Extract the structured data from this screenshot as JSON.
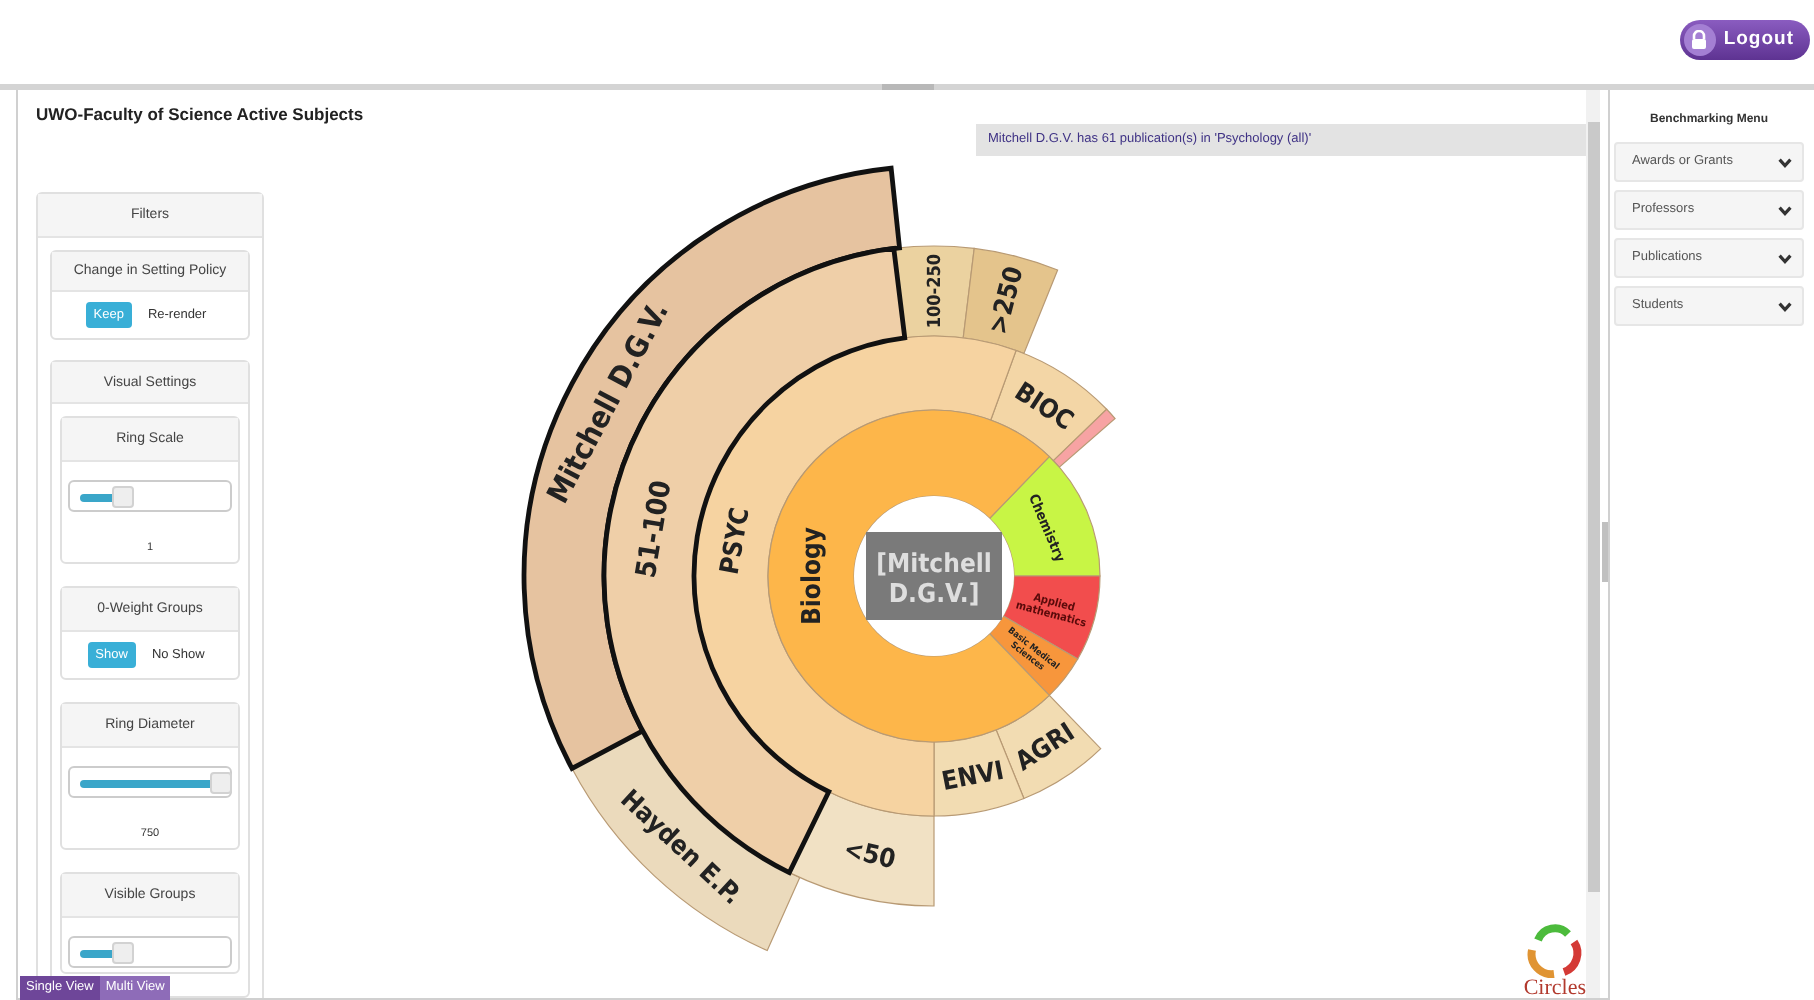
{
  "header": {
    "logout_button": "Logout"
  },
  "panel": {
    "title": "UWO-Faculty of Science Active Subjects",
    "tooltip": "Mitchell D.G.V. has 61 publication(s) in 'Psychology (all)'",
    "filters": {
      "title": "Filters",
      "cards": [
        {
          "kind": "toggle",
          "title": "Change in Setting Policy",
          "options": [
            {
              "label": "Keep",
              "selected": true
            },
            {
              "label": "Re-render",
              "selected": false
            }
          ]
        },
        {
          "kind": "group",
          "title": "Visual Settings",
          "cards": [
            {
              "kind": "slider",
              "title": "Ring Scale",
              "level": 0.3,
              "reading": "1"
            },
            {
              "kind": "toggle",
              "title": "0-Weight Groups",
              "options": [
                {
                  "label": "Show",
                  "selected": true
                },
                {
                  "label": "No Show",
                  "selected": false
                }
              ]
            },
            {
              "kind": "slider",
              "title": "Ring Diameter",
              "level": 1,
              "reading": "750"
            },
            {
              "kind": "slider",
              "title": "Visible Groups",
              "level": 0.3
            }
          ]
        }
      ]
    },
    "rings": [
      [
        {
          "kind": "plain",
          "label": "Chemistry",
          "color": "#c8f545"
        },
        {
          "kind": "plain",
          "label": "Applied mathematics",
          "color": "#f24d4d"
        },
        {
          "kind": "plain",
          "label": "Basic Medical Sciences",
          "color": "#f7963c"
        },
        {
          "kind": "plain",
          "label": "Biology",
          "color": "#fdb64a"
        }
      ],
      [
        {
          "kind": "plain",
          "label": "BIOC",
          "color": "#f3d6a6"
        },
        {
          "kind": "plain",
          "color": "#f7a3a3"
        },
        {
          "kind": "plain",
          "label": "AGRI",
          "color": "#f2dcb2"
        },
        {
          "kind": "plain",
          "label": "ENVI",
          "color": "#f2dcb2"
        },
        {
          "kind": "plain",
          "label": "PSYC",
          "color": "#f6d3a1"
        }
      ],
      [
        {
          "kind": "plain",
          "label": "100-250",
          "color": "#ebd2a0"
        },
        {
          "kind": "plain",
          "label": ">250",
          "color": "#e4c48c"
        },
        {
          "kind": "plain",
          "label": "<50",
          "color": "#f1e1c4"
        },
        {
          "kind": "highlighted",
          "label": "51-100",
          "color": "#efcfa8"
        }
      ],
      [
        {
          "kind": "plain",
          "label": "Hayden E.P.",
          "color": "#ebdabc"
        },
        {
          "kind": "highlighted",
          "label": "Mitchell D.G.V.",
          "color": "#e6c3a0"
        }
      ]
    ],
    "center_label": "[Mitchell D.G.V.]",
    "logo": "Circles"
  },
  "view_buttons": [
    {
      "label": "Single View",
      "selected": true
    },
    {
      "label": "Multi View",
      "selected": false
    }
  ],
  "benchmarking_menu": {
    "title": "Benchmarking Menu",
    "items": [
      {
        "label": "Awards or Grants",
        "expanded": false
      },
      {
        "label": "Professors",
        "expanded": false
      },
      {
        "label": "Publications",
        "expanded": false
      },
      {
        "label": "Students",
        "expanded": false
      }
    ]
  }
}
